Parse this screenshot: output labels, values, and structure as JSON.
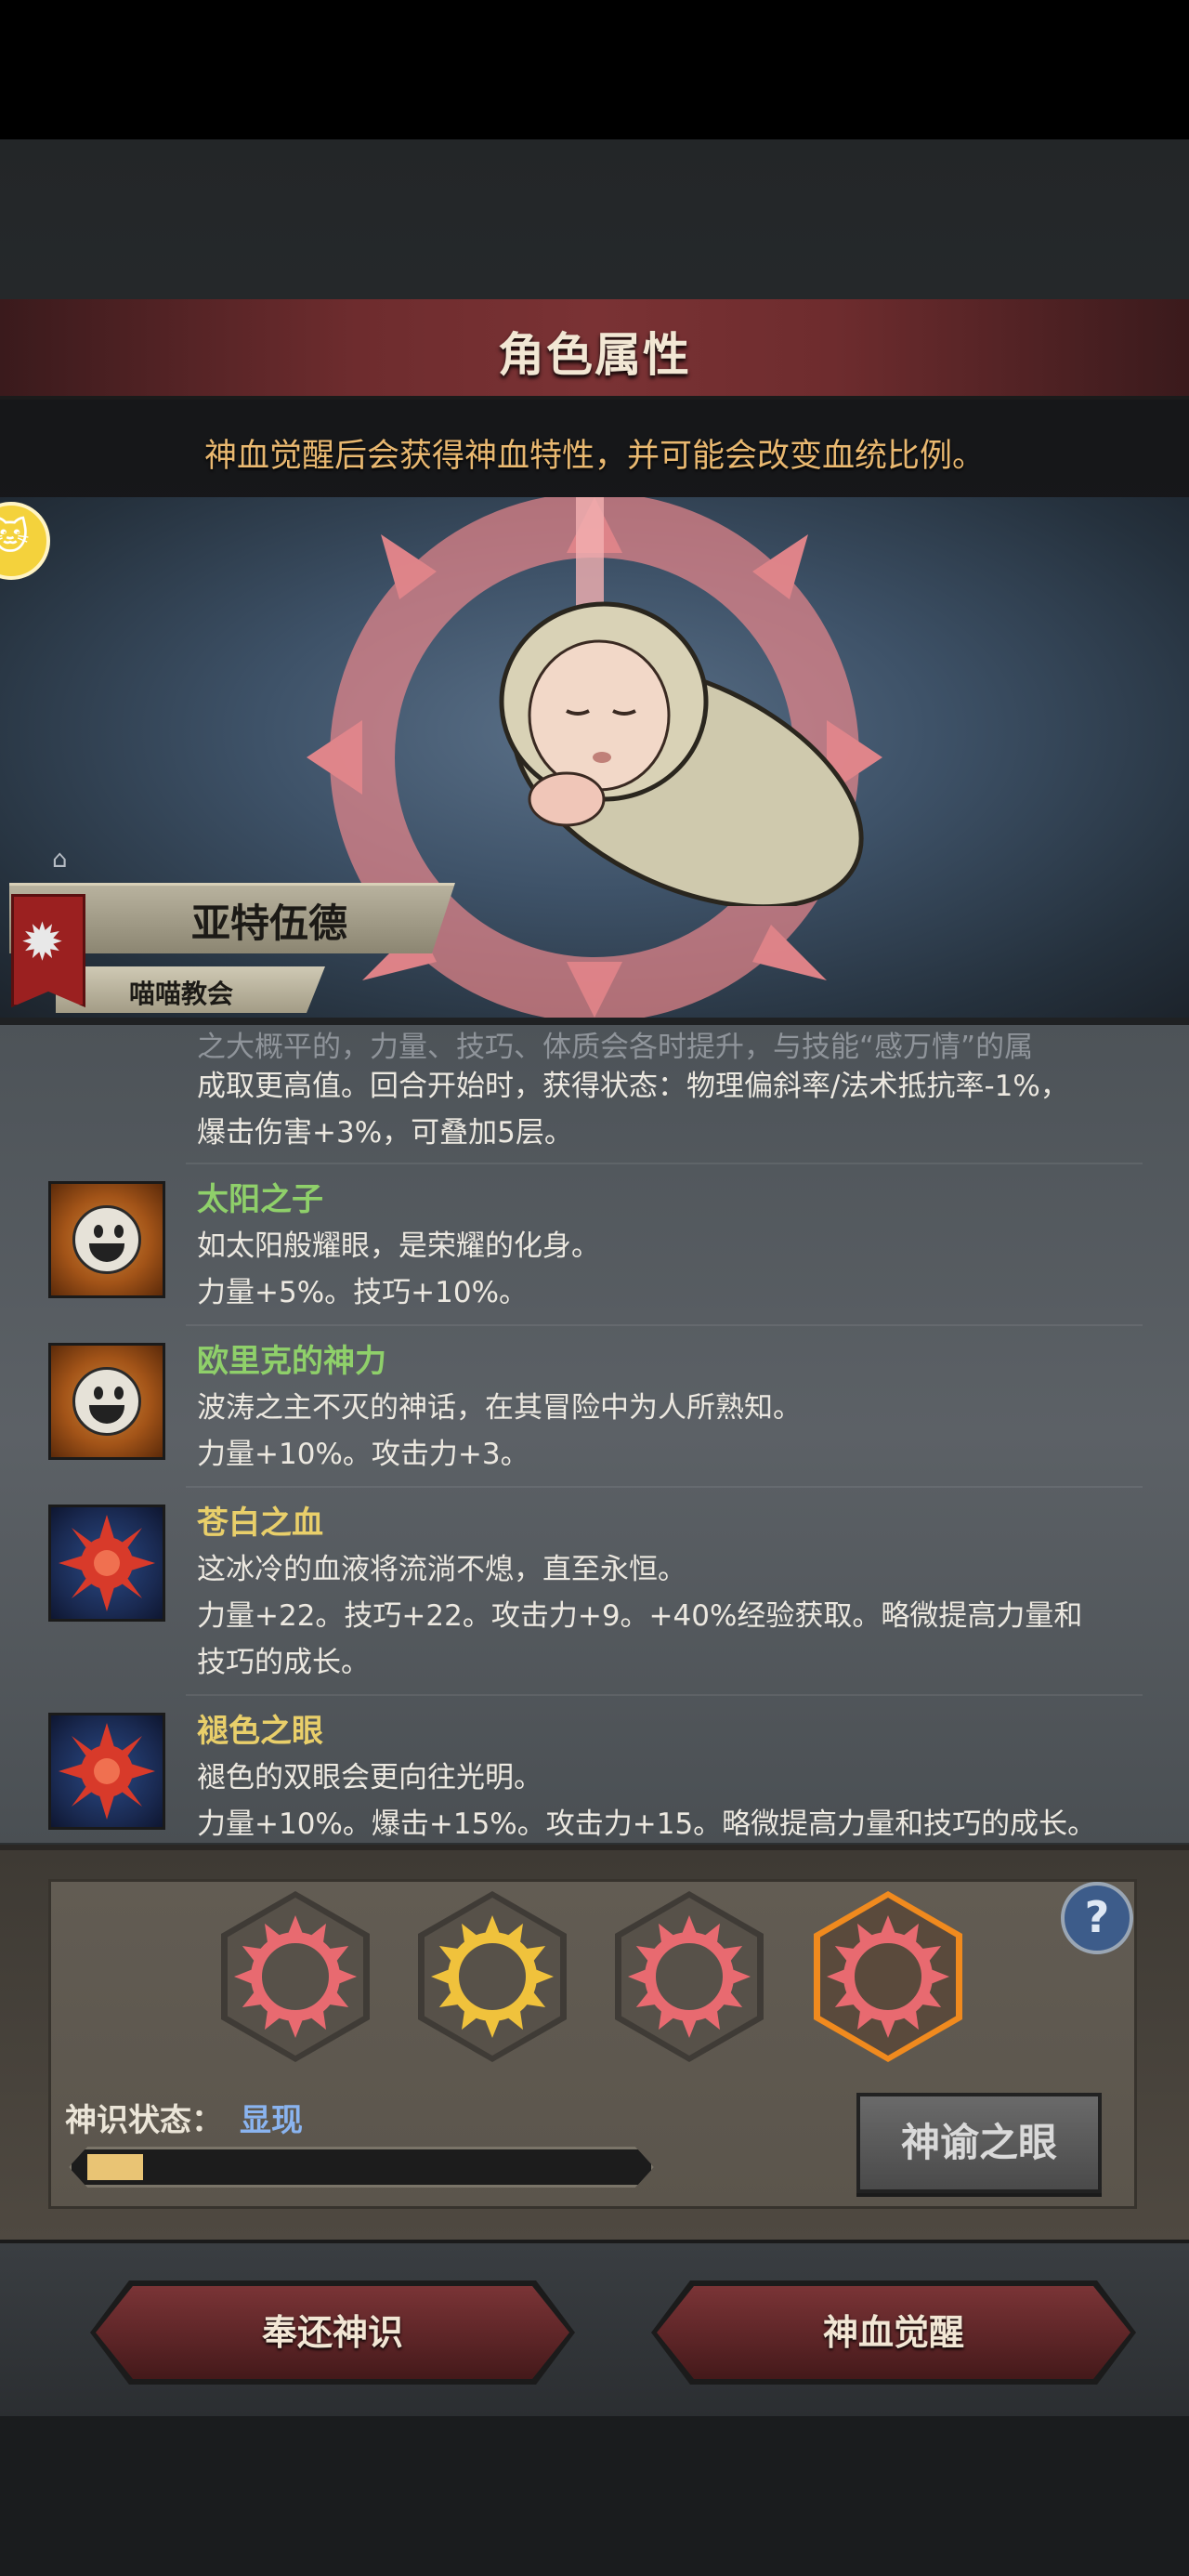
{
  "header": {
    "title": "角色属性",
    "hint": "神血觉醒后会获得神血特性，并可能会改变血统比例。"
  },
  "character": {
    "name": "亚特伍德",
    "guild": "喵喵教会"
  },
  "traits_overflow": {
    "cut_line": "之大概平的，力量、技巧、体质会各时提升，与技能“感万情”的属",
    "line_1": "成取更高值。回合开始时，获得状态：物理偏斜率/法术抵抗率-1%，",
    "line_2": "爆击伤害+3%，可叠加5层。"
  },
  "traits": [
    {
      "name": "太阳之子",
      "color": "#8fd06a",
      "icon": "smile-icon",
      "desc": "如太阳般耀眼，是荣耀的化身。",
      "effects": [
        "力量+5%。技巧+10%。"
      ]
    },
    {
      "name": "欧里克的神力",
      "color": "#8fd06a",
      "icon": "smile-icon",
      "desc": "波涛之主不灭的神话，在其冒险中为人所熟知。",
      "effects": [
        "力量+10%。攻击力+3。"
      ]
    },
    {
      "name": "苍白之血",
      "color": "#e9cf6a",
      "icon": "red-sun-icon",
      "desc": "这冰冷的血液将流淌不熄，直至永恒。",
      "effects": [
        "力量+22。技巧+22。攻击力+9。+40%经验获取。略微提高力量和",
        "技巧的成长。"
      ]
    },
    {
      "name": "褪色之眼",
      "color": "#e9cf6a",
      "icon": "red-sun-icon",
      "desc": "褪色的双眼会更向往光明。",
      "effects": [
        "力量+10%。爆击+15%。攻击力+15。略微提高力量和技巧的成长。"
      ]
    }
  ],
  "panel": {
    "state_label": "神识状态：",
    "state_value": "显现",
    "progress": 0.1,
    "oracle_button": "神谕之眼",
    "help": "?",
    "emblems": [
      {
        "color": "#e86a70",
        "active": false
      },
      {
        "color": "#f0c23c",
        "active": false
      },
      {
        "color": "#e86a70",
        "active": false
      },
      {
        "color": "#e86a70",
        "active": true
      }
    ]
  },
  "actions": {
    "return": "奉还神识",
    "awaken": "神血觉醒"
  }
}
